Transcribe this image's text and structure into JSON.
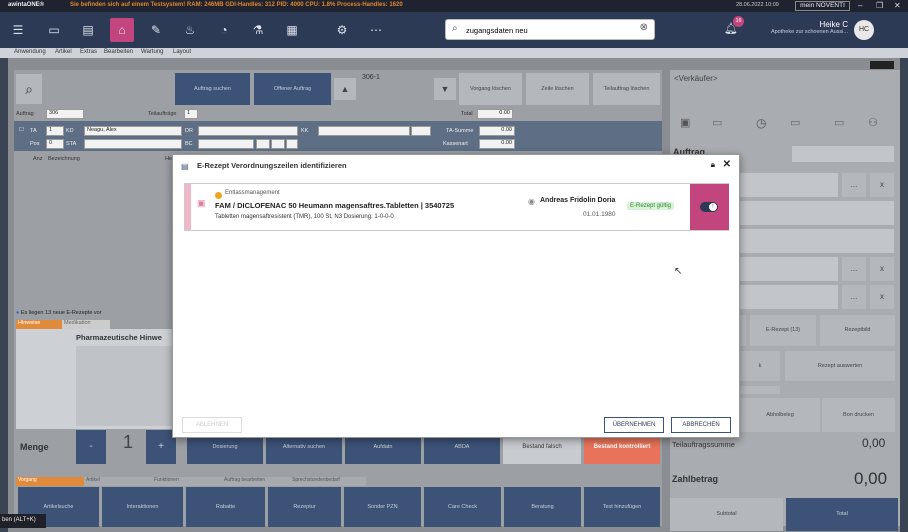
{
  "titlebar": {
    "app_name": "awintaONE®",
    "warning": "Sie befinden sich auf einem Testsystem! RAM: 246MB GDI-Handles: 312 PID: 4000 CPU: 1.8% Process-Handles: 1620",
    "date": "28.06.2022",
    "time": "10:09",
    "brand": "mein NOVENTI"
  },
  "search": {
    "value": "zugangsdaten neu"
  },
  "notifications": {
    "count": "16"
  },
  "user": {
    "name": "Heike C",
    "pharmacy": "Apotheke zur schoenen Aussi...",
    "initials": "HC"
  },
  "menu": [
    "Anwendung",
    "Artikel",
    "Extras",
    "Bearbeiten",
    "Wartung",
    "Layout"
  ],
  "order": {
    "btn_auftrag_suchen": "Auftrag suchen",
    "btn_offener_auftrag": "Offener Auftrag",
    "order_id": "306-1",
    "btn_vorgang_loeschen": "Vorgang löschen",
    "btn_zeile_loeschen": "Zeile löschen",
    "btn_teilauftrag_loeschen": "Teilauftrag löschen",
    "lbl_auftrag": "Auftrag",
    "auftrag_value": "306",
    "lbl_teilauftraege": "Teilaufträge",
    "teilauftraege_value": "1",
    "lbl_total": "Total",
    "total_value": "0.00",
    "lbl_ta": "TA",
    "ta_value": "1",
    "lbl_kd": "KD",
    "kd_value": "Neagu, Alex",
    "lbl_dr": "DR",
    "lbl_kk": "KK",
    "lbl_ta_summe": "TA-Summe",
    "ta_summe_value": "0.00",
    "lbl_pos": "Pos",
    "pos_value": "0",
    "lbl_sta": "STA",
    "lbl_bc": "BC",
    "lbl_kassenart": "Kassenart",
    "kassenart_value": "0.00",
    "lbl_anz": "Anz",
    "lbl_bezeichnung": "Bezeichnung",
    "lbl_he": "He"
  },
  "info": {
    "text": "Es liegen 13 neue E-Rezepte vor"
  },
  "tabs": [
    "Hinweise",
    "Medikation"
  ],
  "pharma": {
    "title": "Pharmazeutische Hinwe"
  },
  "menge": {
    "label": "Menge",
    "minus": "-",
    "value": "1",
    "plus": "+"
  },
  "action_row": [
    "Dosierung",
    "Alternativ suchen",
    "Aufdatn",
    "ABDA",
    "Bestand falsch",
    "Bestand kontrolliert"
  ],
  "bottom_tabs": [
    "Vorgang",
    "Artikel",
    "Funktionen",
    "Auftrag bearbeiten",
    "Sprechstundenbedarf"
  ],
  "bottom_buttons": [
    "Artikelsuche",
    "Interaktionen",
    "Rabatte",
    "Rezeptur",
    "Sonder PZN",
    "Care Check",
    "Beratung",
    "Text hinzufügen"
  ],
  "status": {
    "shortcut": "ben (ALT+K)"
  },
  "right": {
    "verkaeufer": "<Verkäufer>",
    "auftrag_label": "Auftrag",
    "ellipsis": "...",
    "x": "x",
    "btn_erezept": "E-Rezept (13)",
    "btn_rezeptbild": "Rezeptbild",
    "btn_k": "k",
    "btn_rezept_auswerten": "Rezept auswerten",
    "btn_abholbeleg": "Abholbeleg",
    "btn_bon_drucken": "Bon drucken",
    "teilauftragssumme_label": "Teilauftragssumme",
    "teilauftragssumme_value": "0,00",
    "zahlbetrag_label": "Zahlbetrag",
    "zahlbetrag_value": "0,00",
    "btn_subtotal": "Subtotal",
    "btn_total": "Total"
  },
  "dialog": {
    "title": "E-Rezept Verordnungszeilen identifizieren",
    "category": "Entlassmanagement",
    "medication": "FAM / DICLOFENAC 50 Heumann magensaftres.Tabletten | 3540725",
    "details": "Tabletten magensaftresistent (TMR), 100 St, N3  Dosierung: 1-0-0-0",
    "patient_name": "Andreas Fridolin Doria",
    "patient_dob": "01.01.1980",
    "status": "E-Rezept gültig",
    "btn_ablehnen": "ABLEHNEN",
    "btn_uebernehmen": "ÜBERNEHMEN",
    "btn_abbrechen": "ABBRECHEN"
  },
  "colors": {
    "primary": "#2d3a55",
    "accent": "#c2457e",
    "valid_green": "#2e8b2e",
    "warning_orange": "#e0862b"
  }
}
